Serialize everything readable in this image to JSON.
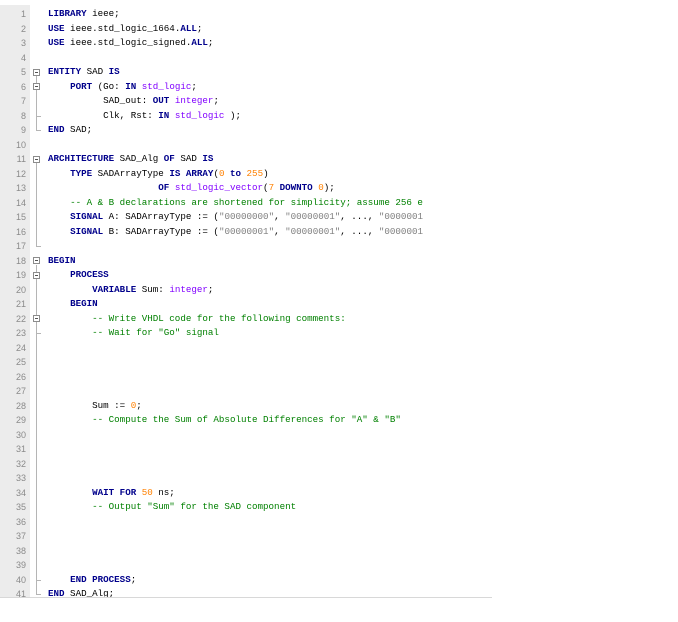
{
  "editor": {
    "language": "vhdl",
    "line_numbers": [
      "1",
      "2",
      "3",
      "4",
      "5",
      "6",
      "7",
      "8",
      "9",
      "10",
      "11",
      "12",
      "13",
      "14",
      "15",
      "16",
      "17",
      "18",
      "19",
      "20",
      "21",
      "22",
      "23",
      "24",
      "25",
      "26",
      "27",
      "28",
      "29",
      "30",
      "31",
      "32",
      "33",
      "34",
      "35",
      "36",
      "37",
      "38",
      "39",
      "40",
      "41"
    ],
    "lines": [
      [
        {
          "t": "kw",
          "v": "LIBRARY"
        },
        {
          "t": "",
          "v": " ieee;"
        }
      ],
      [
        {
          "t": "kw",
          "v": "USE"
        },
        {
          "t": "",
          "v": " ieee.std_logic_1664."
        },
        {
          "t": "kw",
          "v": "ALL"
        },
        {
          "t": "",
          "v": ";"
        }
      ],
      [
        {
          "t": "kw",
          "v": "USE"
        },
        {
          "t": "",
          "v": " ieee.std_logic_signed."
        },
        {
          "t": "kw",
          "v": "ALL"
        },
        {
          "t": "",
          "v": ";"
        }
      ],
      [],
      [
        {
          "t": "kw",
          "v": "ENTITY"
        },
        {
          "t": "",
          "v": " SAD "
        },
        {
          "t": "kw",
          "v": "IS"
        }
      ],
      [
        {
          "t": "",
          "v": "    "
        },
        {
          "t": "kw",
          "v": "PORT"
        },
        {
          "t": "",
          "v": " (Go: "
        },
        {
          "t": "kw",
          "v": "IN"
        },
        {
          "t": "",
          "v": " "
        },
        {
          "t": "ty",
          "v": "std_logic"
        },
        {
          "t": "",
          "v": ";"
        }
      ],
      [
        {
          "t": "",
          "v": "          SAD_out: "
        },
        {
          "t": "kw",
          "v": "OUT"
        },
        {
          "t": "",
          "v": " "
        },
        {
          "t": "ty",
          "v": "integer"
        },
        {
          "t": "",
          "v": ";"
        }
      ],
      [
        {
          "t": "",
          "v": "          Clk, Rst: "
        },
        {
          "t": "kw",
          "v": "IN"
        },
        {
          "t": "",
          "v": " "
        },
        {
          "t": "ty",
          "v": "std_logic"
        },
        {
          "t": "",
          "v": " );"
        }
      ],
      [
        {
          "t": "kw",
          "v": "END"
        },
        {
          "t": "",
          "v": " SAD;"
        }
      ],
      [],
      [
        {
          "t": "kw",
          "v": "ARCHITECTURE"
        },
        {
          "t": "",
          "v": " SAD_Alg "
        },
        {
          "t": "kw",
          "v": "OF"
        },
        {
          "t": "",
          "v": " SAD "
        },
        {
          "t": "kw",
          "v": "IS"
        }
      ],
      [
        {
          "t": "",
          "v": "    "
        },
        {
          "t": "kw",
          "v": "TYPE"
        },
        {
          "t": "",
          "v": " SADArrayType "
        },
        {
          "t": "kw",
          "v": "IS"
        },
        {
          "t": "",
          "v": " "
        },
        {
          "t": "kw",
          "v": "ARRAY"
        },
        {
          "t": "",
          "v": "("
        },
        {
          "t": "num",
          "v": "0"
        },
        {
          "t": "",
          "v": " "
        },
        {
          "t": "kw",
          "v": "to"
        },
        {
          "t": "",
          "v": " "
        },
        {
          "t": "num",
          "v": "255"
        },
        {
          "t": "",
          "v": ")"
        }
      ],
      [
        {
          "t": "",
          "v": "                    "
        },
        {
          "t": "kw",
          "v": "OF"
        },
        {
          "t": "",
          "v": " "
        },
        {
          "t": "ty",
          "v": "std_logic_vector"
        },
        {
          "t": "",
          "v": "("
        },
        {
          "t": "num",
          "v": "7"
        },
        {
          "t": "",
          "v": " "
        },
        {
          "t": "kw",
          "v": "DOWNTO"
        },
        {
          "t": "",
          "v": " "
        },
        {
          "t": "num",
          "v": "0"
        },
        {
          "t": "",
          "v": ");"
        }
      ],
      [
        {
          "t": "",
          "v": "    "
        },
        {
          "t": "cmt",
          "v": "-- A & B declarations are shortened for simplicity; assume 256 e"
        }
      ],
      [
        {
          "t": "",
          "v": "    "
        },
        {
          "t": "kw",
          "v": "SIGNAL"
        },
        {
          "t": "",
          "v": " A: SADArrayType := ("
        },
        {
          "t": "str",
          "v": "\"00000000\""
        },
        {
          "t": "",
          "v": ", "
        },
        {
          "t": "str",
          "v": "\"00000001\""
        },
        {
          "t": "",
          "v": ", ..., "
        },
        {
          "t": "str",
          "v": "\"0000001"
        }
      ],
      [
        {
          "t": "",
          "v": "    "
        },
        {
          "t": "kw",
          "v": "SIGNAL"
        },
        {
          "t": "",
          "v": " B: SADArrayType := ("
        },
        {
          "t": "str",
          "v": "\"00000001\""
        },
        {
          "t": "",
          "v": ", "
        },
        {
          "t": "str",
          "v": "\"00000001\""
        },
        {
          "t": "",
          "v": ", ..., "
        },
        {
          "t": "str",
          "v": "\"0000001"
        }
      ],
      [],
      [
        {
          "t": "kw",
          "v": "BEGIN"
        }
      ],
      [
        {
          "t": "",
          "v": "    "
        },
        {
          "t": "kw",
          "v": "PROCESS"
        }
      ],
      [
        {
          "t": "",
          "v": "        "
        },
        {
          "t": "kw",
          "v": "VARIABLE"
        },
        {
          "t": "",
          "v": " Sum: "
        },
        {
          "t": "ty",
          "v": "integer"
        },
        {
          "t": "",
          "v": ";"
        }
      ],
      [
        {
          "t": "",
          "v": "    "
        },
        {
          "t": "kw",
          "v": "BEGIN"
        }
      ],
      [
        {
          "t": "",
          "v": "        "
        },
        {
          "t": "cmt",
          "v": "-- Write VHDL code for the following comments:"
        }
      ],
      [
        {
          "t": "",
          "v": "        "
        },
        {
          "t": "cmt",
          "v": "-- Wait for \"Go\" signal"
        }
      ],
      [],
      [],
      [],
      [],
      [
        {
          "t": "",
          "v": "        Sum := "
        },
        {
          "t": "num",
          "v": "0"
        },
        {
          "t": "",
          "v": ";"
        }
      ],
      [
        {
          "t": "",
          "v": "        "
        },
        {
          "t": "cmt",
          "v": "-- Compute the Sum of Absolute Differences for \"A\" & \"B\""
        }
      ],
      [],
      [],
      [],
      [],
      [
        {
          "t": "",
          "v": "        "
        },
        {
          "t": "kw",
          "v": "WAIT FOR"
        },
        {
          "t": "",
          "v": " "
        },
        {
          "t": "num",
          "v": "50"
        },
        {
          "t": "",
          "v": " ns;"
        }
      ],
      [
        {
          "t": "",
          "v": "        "
        },
        {
          "t": "cmt",
          "v": "-- Output \"Sum\" for the SAD component"
        }
      ],
      [],
      [],
      [],
      [],
      [
        {
          "t": "",
          "v": "    "
        },
        {
          "t": "kw",
          "v": "END PROCESS"
        },
        {
          "t": "",
          "v": ";"
        }
      ],
      [
        {
          "t": "kw",
          "v": "END"
        },
        {
          "t": "",
          "v": " SAD_Alg;"
        }
      ]
    ],
    "colors": {
      "keyword": "#00008b",
      "type": "#8000ff",
      "number": "#ff8000",
      "string": "#7f7f7f",
      "comment": "#008000",
      "gutter_bg": "#ececec",
      "line_number": "#8a8a8a"
    }
  }
}
